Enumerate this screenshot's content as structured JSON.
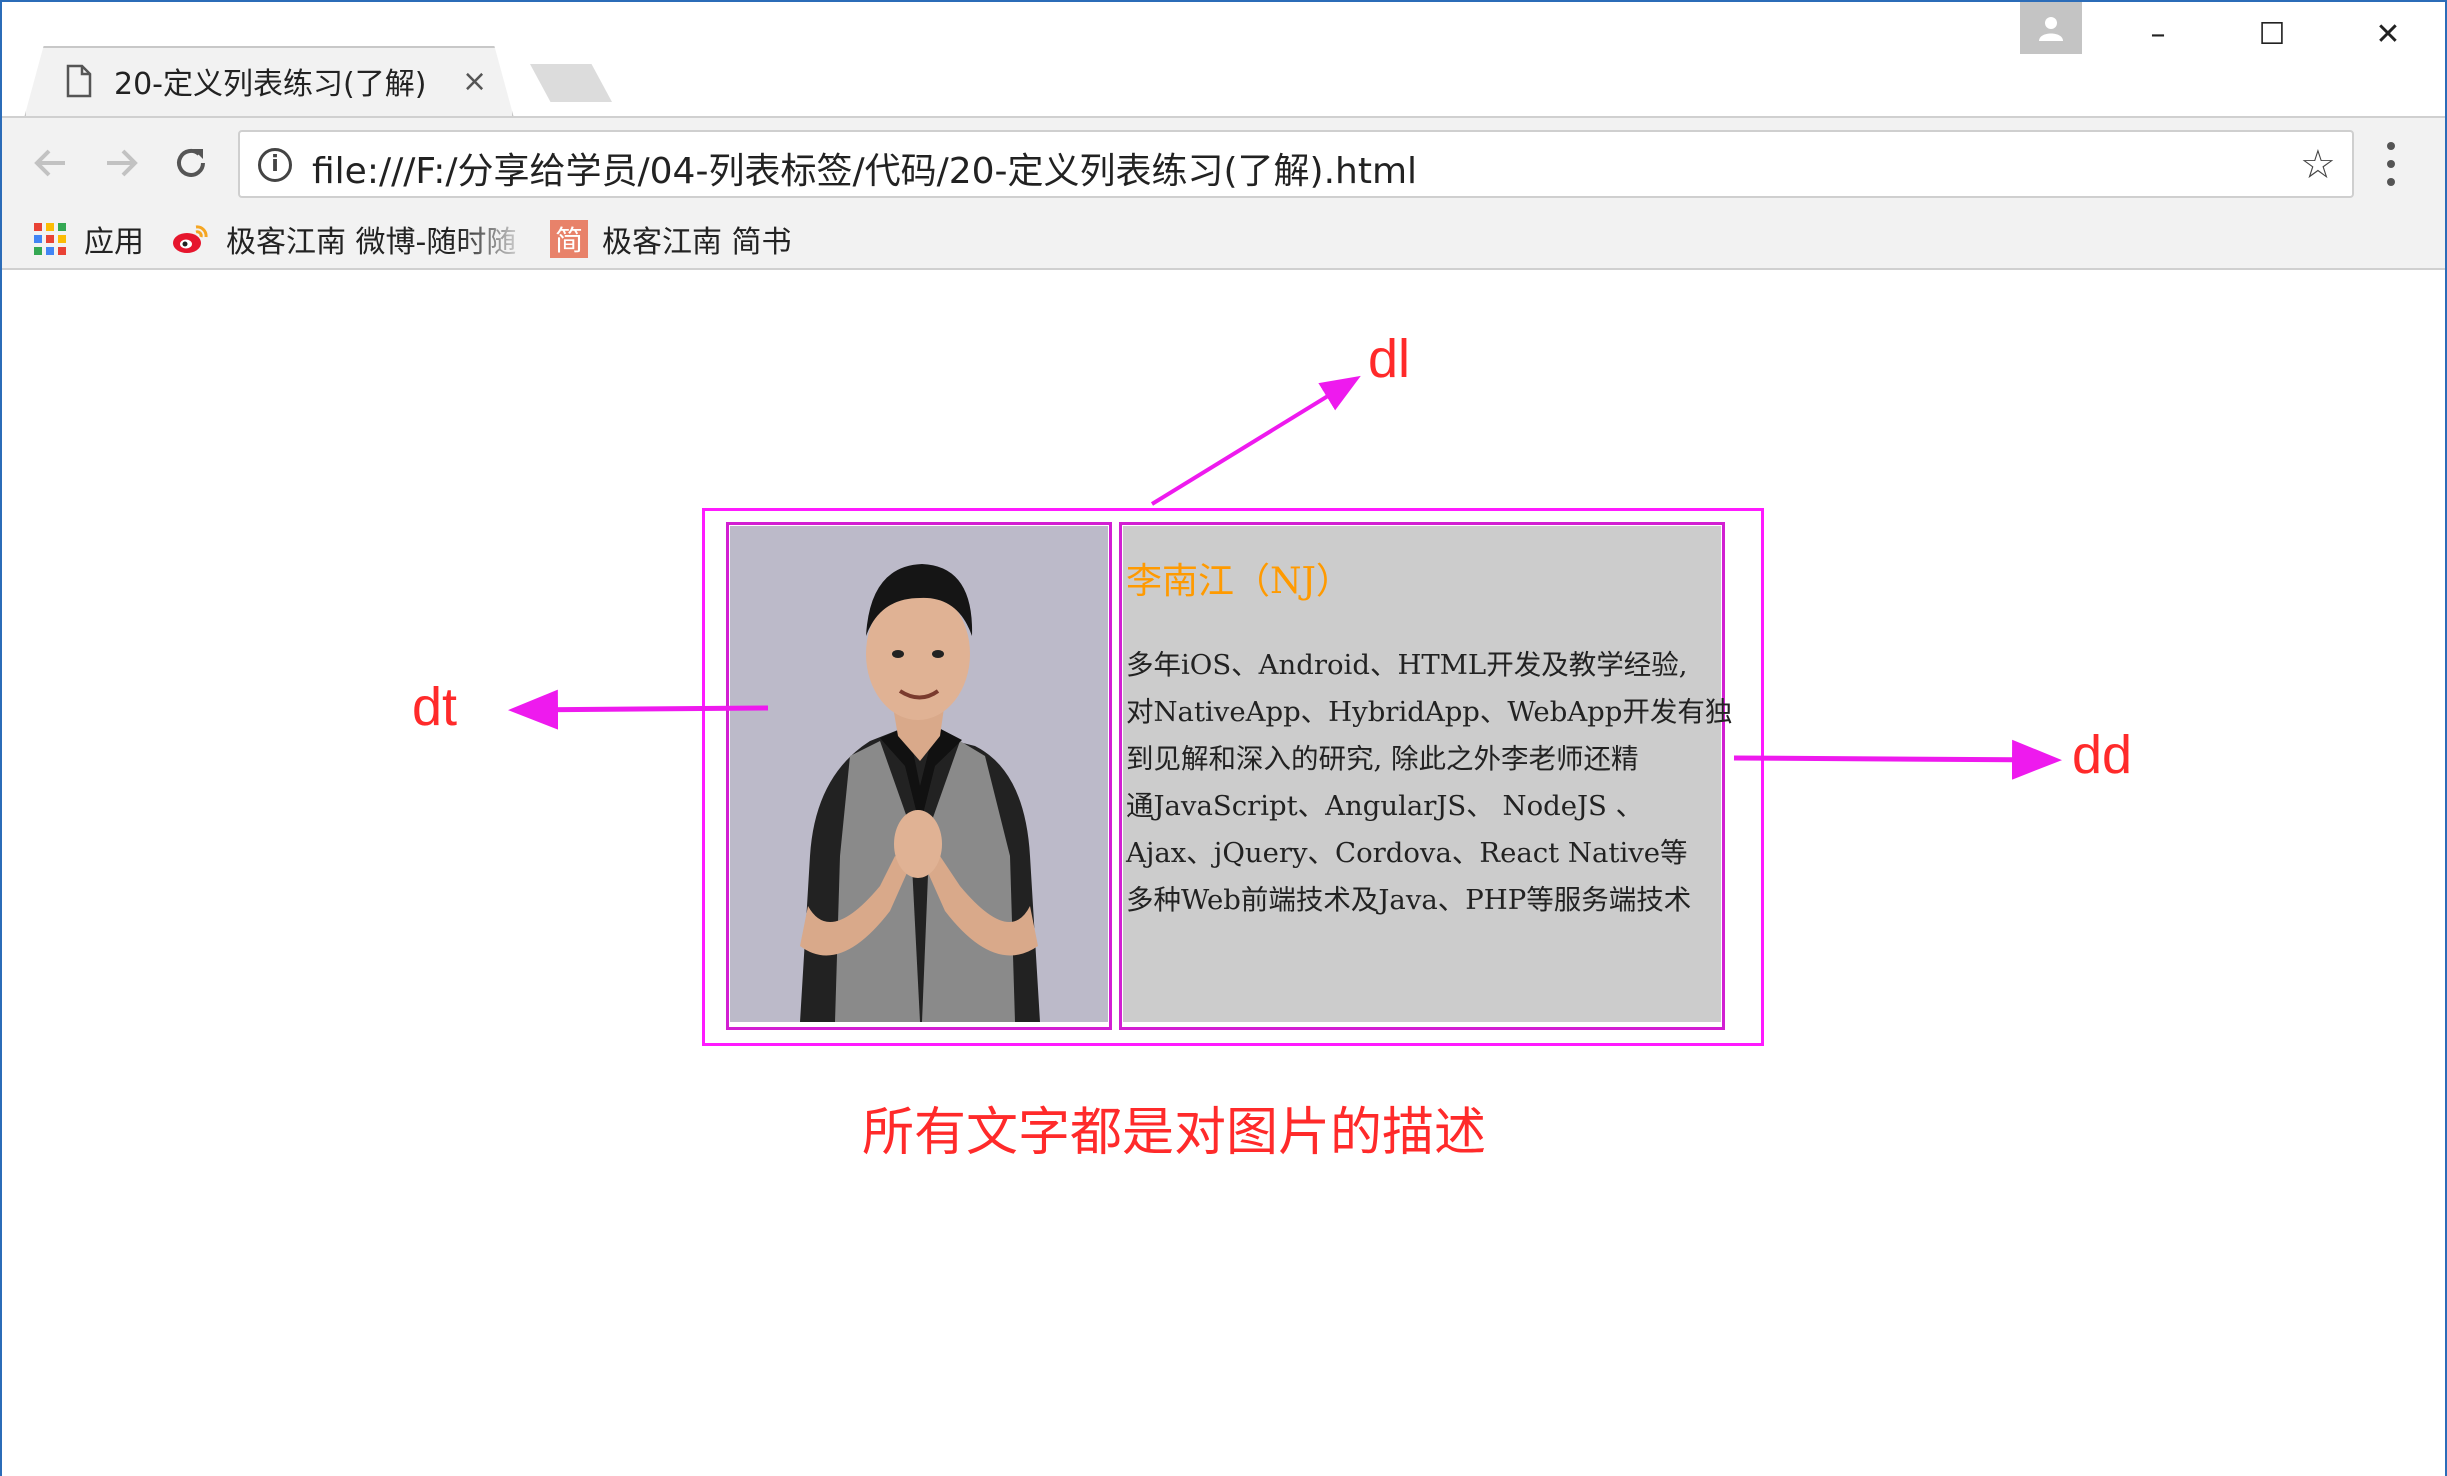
{
  "tab": {
    "title": "20-定义列表练习(了解)",
    "close": "×"
  },
  "window_controls": {
    "minimize": "–",
    "maximize": "☐",
    "close": "✕"
  },
  "address_bar": {
    "url": "file:///F:/分享给学员/04-列表标签/代码/20-定义列表练习(了解).html"
  },
  "bookmarks": [
    {
      "label": "应用",
      "icon": "apps-grid-icon"
    },
    {
      "label": "极客江南 微博-随时随",
      "icon": "weibo-icon"
    },
    {
      "label": "极客江南 简书",
      "icon": "jianshu-icon",
      "icon_text": "简"
    }
  ],
  "page": {
    "dd_title": "李南江（NJ）",
    "dd_lines": [
      "多年iOS、Android、HTML开发及教学经验,",
      "对NativeApp、HybridApp、WebApp开发有独",
      "到见解和深入的研究, 除此之外李老师还精",
      "通JavaScript、AngularJS、 NodeJS 、",
      "Ajax、jQuery、Cordova、React Native等",
      "多种Web前端技术及Java、PHP等服务端技术"
    ],
    "annotations": {
      "dl": "dl",
      "dt": "dt",
      "dd": "dd"
    },
    "caption": "所有文字都是对图片的描述"
  },
  "colors": {
    "annotation": "#ff2a2a",
    "outline": "#ff1aff",
    "title_orange": "#ff9a00",
    "photo_bg": "#bcbac9",
    "dd_bg": "#cccccc"
  }
}
